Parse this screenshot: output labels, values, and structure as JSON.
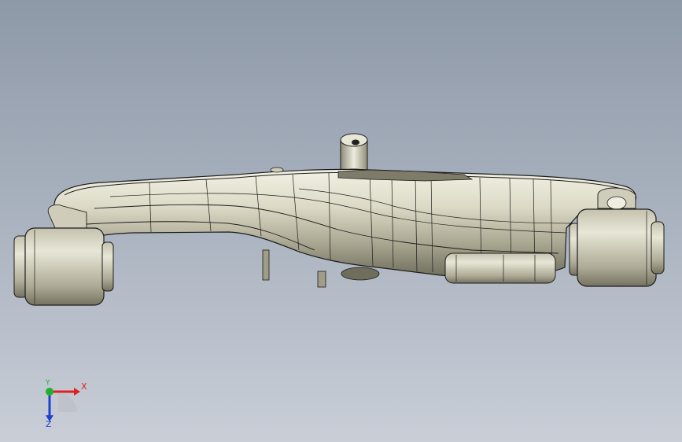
{
  "viewport": {
    "background_top": "#8e99a8",
    "background_bottom": "#c9ced7"
  },
  "model": {
    "part_color": "#d9d7c3",
    "edge_color": "#1c1c1c"
  },
  "triad": {
    "x_label": "X",
    "y_label": "Y",
    "z_label": "Z",
    "x_color": "#e02020",
    "y_color": "#20b030",
    "z_color": "#2040d0"
  }
}
